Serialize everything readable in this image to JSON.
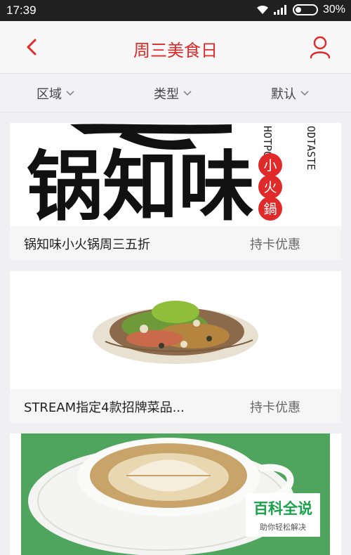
{
  "status": {
    "time": "17:39",
    "battery": "30%",
    "battery_level": 0.3
  },
  "header": {
    "title": "周三美食日"
  },
  "filters": [
    {
      "label": "区域"
    },
    {
      "label": "类型"
    },
    {
      "label": "默认"
    }
  ],
  "cards": [
    {
      "name": "锅知味小火锅周三五折",
      "tag": "持卡优惠",
      "image": "hotpot-logo"
    },
    {
      "name": "STREAM指定4款招牌菜品...",
      "tag": "持卡优惠",
      "image": "salad-dish"
    },
    {
      "name": "",
      "tag": "",
      "image": "latte-art-coffee"
    }
  ],
  "logo_text": {
    "chinese": "锅知味",
    "seal": [
      "小",
      "火",
      "鍋"
    ],
    "english_1": "HOTPOT",
    "english_2": "ODTASTE"
  },
  "watermark": {
    "title": "百科全说",
    "subtitle": "助你轻松解决"
  },
  "colors": {
    "accent": "#e02a2a",
    "watermark_green": "#1aa24a",
    "coffee_bg": "#4fa55e"
  }
}
